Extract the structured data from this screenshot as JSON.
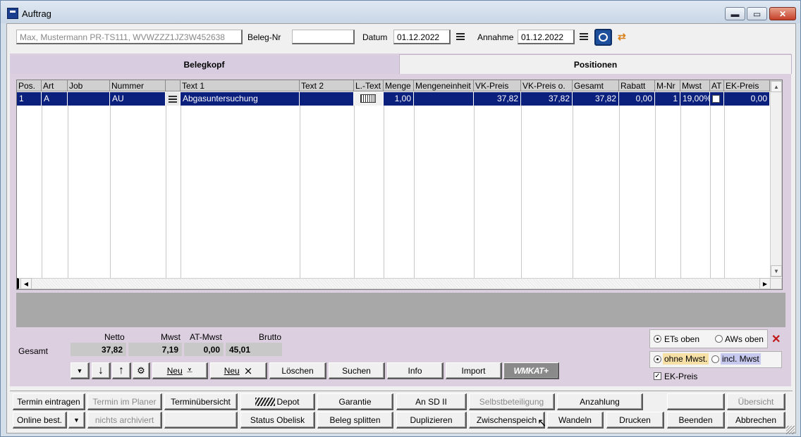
{
  "window": {
    "title": "Auftrag",
    "min": "▬",
    "max": "▭",
    "close": "✕"
  },
  "header": {
    "customer": "Max, Mustermann PR-TS111, WVWZZZ1JZ3W452638",
    "beleg_label": "Beleg-Nr",
    "beleg_value": "",
    "datum_label": "Datum",
    "datum_value": "01.12.2022",
    "annahme_label": "Annahme",
    "annahme_value": "01.12.2022"
  },
  "tabs": [
    {
      "label": "Belegkopf"
    },
    {
      "label": "Positionen"
    }
  ],
  "grid": {
    "columns": [
      "Pos.",
      "Art",
      "Job",
      "Nummer",
      "",
      "Text 1",
      "Text 2",
      "L.-Text",
      "Menge",
      "Mengeneinheit",
      "VK-Preis",
      "VK-Preis o.",
      "Gesamt",
      "Rabatt",
      "M-Nr",
      "Mwst",
      "AT",
      "EK-Preis"
    ],
    "rows": [
      {
        "pos": "1",
        "art": "A",
        "job": "",
        "nummer": "AU",
        "text1": "Abgasuntersuchung",
        "text2": "",
        "menge": "1,00",
        "einheit": "",
        "vk": "37,82",
        "vko": "37,82",
        "gesamt": "37,82",
        "rabatt": "0,00",
        "mnr": "1",
        "mwst": "19,00%",
        "ek": "0,00"
      }
    ]
  },
  "totals": {
    "gesamt_label": "Gesamt",
    "netto_label": "Netto",
    "netto": "37,82",
    "mwst_label": "Mwst",
    "mwst": "7,19",
    "atmwst_label": "AT-Mwst",
    "atmwst": "0,00",
    "brutto_label": "Brutto",
    "brutto": "45,01"
  },
  "actions": {
    "neu1": "Neu",
    "neu2": "Neu",
    "loeschen": "Löschen",
    "suchen": "Suchen",
    "info": "Info",
    "import": "Import",
    "wmkat": "WMKAT+"
  },
  "options": {
    "ets_oben": "ETs oben",
    "aws_oben": "AWs oben",
    "ohne_mwst": "ohne Mwst.",
    "incl_mwst": "incl. Mwst",
    "ek_preis": "EK-Preis"
  },
  "bottom": {
    "termin_eintragen": "Termin eintragen",
    "termin_planer": "Termin im Planer",
    "terminuebersicht": "Terminübersicht",
    "depot": "Depot",
    "garantie": "Garantie",
    "an_sd": "An SD II",
    "selbstbeteiligung": "Selbstbeteiligung",
    "anzahlung": "Anzahlung",
    "uebersicht": "Übersicht",
    "online_best": "Online best.",
    "nicht_archiviert": "nichts archiviert",
    "status_obelisk": "Status Obelisk",
    "beleg_splitten": "Beleg splitten",
    "duplizieren": "Duplizieren",
    "zwischenspeichern": "Zwischenspeich",
    "wandeln": "Wandeln",
    "drucken": "Drucken",
    "beenden": "Beenden",
    "abbrechen": "Abbrechen"
  }
}
